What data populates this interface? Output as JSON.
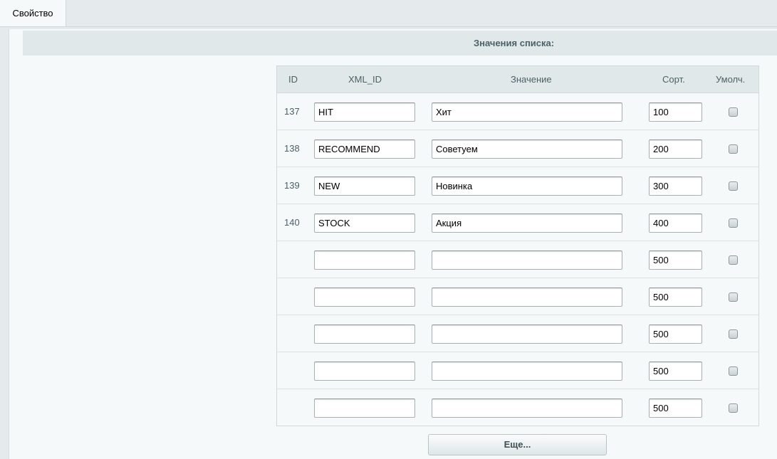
{
  "tab": {
    "label": "Свойство"
  },
  "section": {
    "title": "Значения списка:"
  },
  "table": {
    "headers": {
      "id": "ID",
      "xml_id": "XML_ID",
      "value": "Значение",
      "sort": "Сорт.",
      "default": "Умолч."
    },
    "rows": [
      {
        "id": "137",
        "xml_id": "HIT",
        "value": "Хит",
        "sort": "100",
        "default": false
      },
      {
        "id": "138",
        "xml_id": "RECOMMEND",
        "value": "Советуем",
        "sort": "200",
        "default": false
      },
      {
        "id": "139",
        "xml_id": "NEW",
        "value": "Новинка",
        "sort": "300",
        "default": false
      },
      {
        "id": "140",
        "xml_id": "STOCK",
        "value": "Акция",
        "sort": "400",
        "default": false
      },
      {
        "id": "",
        "xml_id": "",
        "value": "",
        "sort": "500",
        "default": false
      },
      {
        "id": "",
        "xml_id": "",
        "value": "",
        "sort": "500",
        "default": false
      },
      {
        "id": "",
        "xml_id": "",
        "value": "",
        "sort": "500",
        "default": false
      },
      {
        "id": "",
        "xml_id": "",
        "value": "",
        "sort": "500",
        "default": false
      },
      {
        "id": "",
        "xml_id": "",
        "value": "",
        "sort": "500",
        "default": false
      }
    ]
  },
  "more_button": {
    "label": "Еще..."
  }
}
